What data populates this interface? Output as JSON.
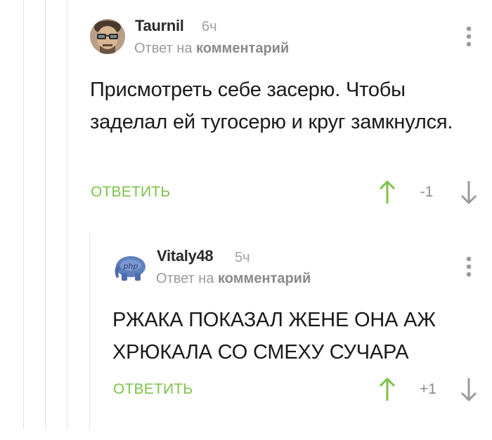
{
  "comments": [
    {
      "author": "Taurnil",
      "time": "6ч",
      "reply_prefix": "Ответ на",
      "reply_link": "комментарий",
      "text": "Присмотреть себе засерю. Чтобы заделал ей тугосерю и круг замкнулся.",
      "reply_label": "ОТВЕТИТЬ",
      "rating": "-1",
      "avatar_icon": "man-with-glasses-avatar"
    },
    {
      "author": "Vitaly48",
      "time": "5ч",
      "reply_prefix": "Ответ на",
      "reply_link": "комментарий",
      "text": "РЖАКА ПОКАЗАЛ ЖЕНЕ ОНА АЖ ХРЮКАЛА СО СМЕХУ СУЧАРА",
      "reply_label": "ОТВЕТИТЬ",
      "rating": "+1",
      "avatar_icon": "php-elephant-avatar",
      "avatar_text": "php"
    }
  ],
  "colors": {
    "accent_green": "#7cc24a",
    "muted_gray": "#9a9a9a",
    "thread_line": "#e4e4e4"
  }
}
